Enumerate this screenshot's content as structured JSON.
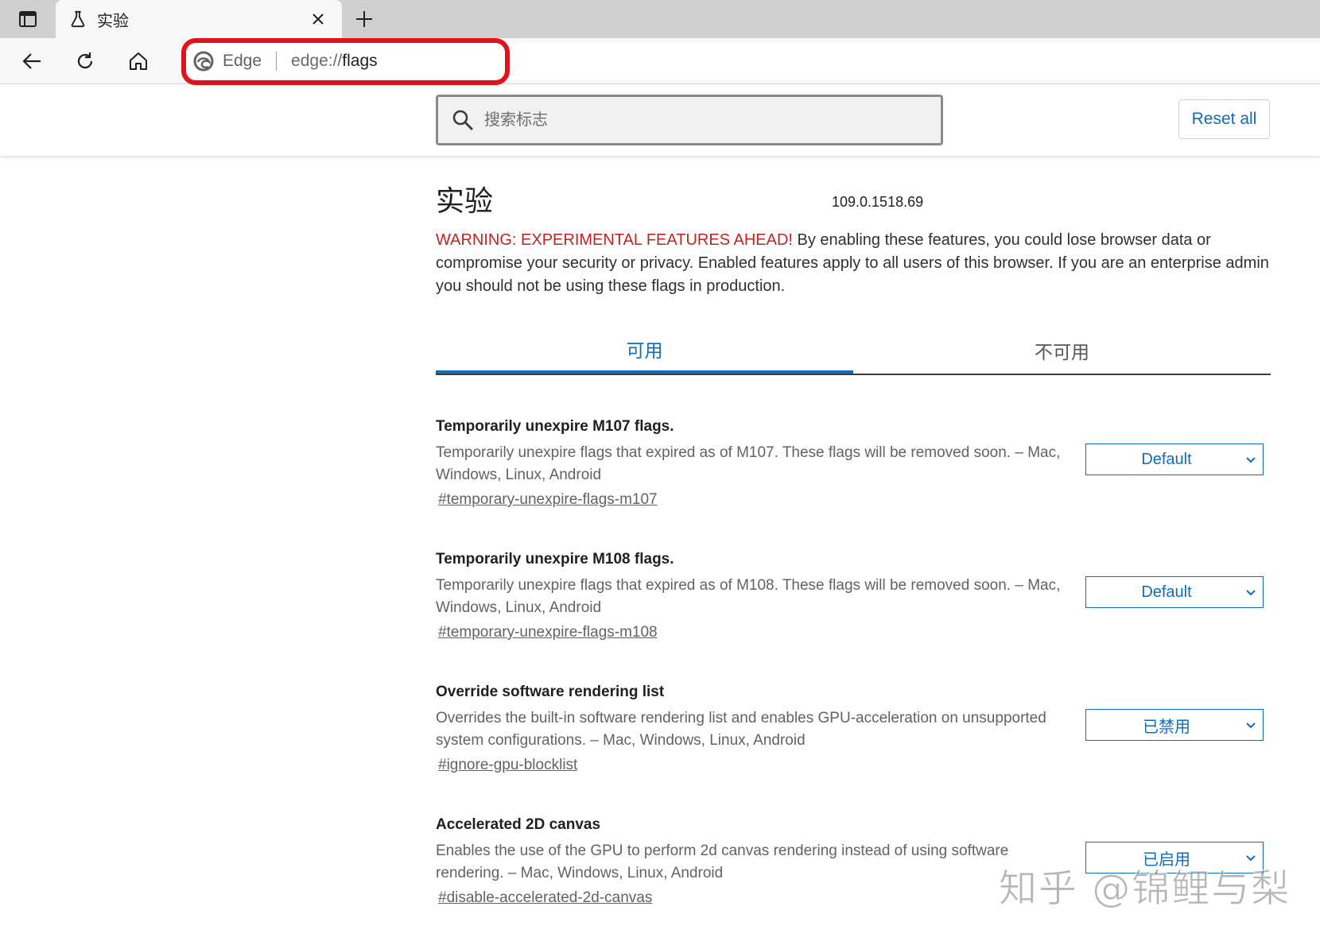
{
  "tab": {
    "title": "实验"
  },
  "toolbar": {
    "site_name": "Edge",
    "url_scheme": "edge://",
    "url_path": "flags"
  },
  "header": {
    "search_placeholder": "搜索标志",
    "reset_label": "Reset all"
  },
  "page": {
    "title": "实验",
    "version": "109.0.1518.69",
    "warning_red": "WARNING: EXPERIMENTAL FEATURES AHEAD!",
    "warning_rest": " By enabling these features, you could lose browser data or compromise your security or privacy. Enabled features apply to all users of this browser. If you are an enterprise admin you should not be using these flags in production."
  },
  "tabs": [
    {
      "label": "可用",
      "active": true
    },
    {
      "label": "不可用",
      "active": false
    }
  ],
  "experiments": [
    {
      "title": "Temporarily unexpire M107 flags.",
      "description": "Temporarily unexpire flags that expired as of M107. These flags will be removed soon. – Mac, Windows, Linux, Android",
      "link": "#temporary-unexpire-flags-m107",
      "value": "Default"
    },
    {
      "title": "Temporarily unexpire M108 flags.",
      "description": "Temporarily unexpire flags that expired as of M108. These flags will be removed soon. – Mac, Windows, Linux, Android",
      "link": "#temporary-unexpire-flags-m108",
      "value": "Default"
    },
    {
      "title": "Override software rendering list",
      "description": "Overrides the built-in software rendering list and enables GPU-acceleration on unsupported system configurations. – Mac, Windows, Linux, Android",
      "link": "#ignore-gpu-blocklist",
      "value": "已禁用"
    },
    {
      "title": "Accelerated 2D canvas",
      "description": "Enables the use of the GPU to perform 2d canvas rendering instead of using software rendering. – Mac, Windows, Linux, Android",
      "link": "#disable-accelerated-2d-canvas",
      "value": "已启用"
    }
  ],
  "watermark": "知乎 @锦鲤与梨",
  "colors": {
    "accent": "#0f6cbd",
    "warning": "#c5221f",
    "highlight": "#e0121b"
  }
}
